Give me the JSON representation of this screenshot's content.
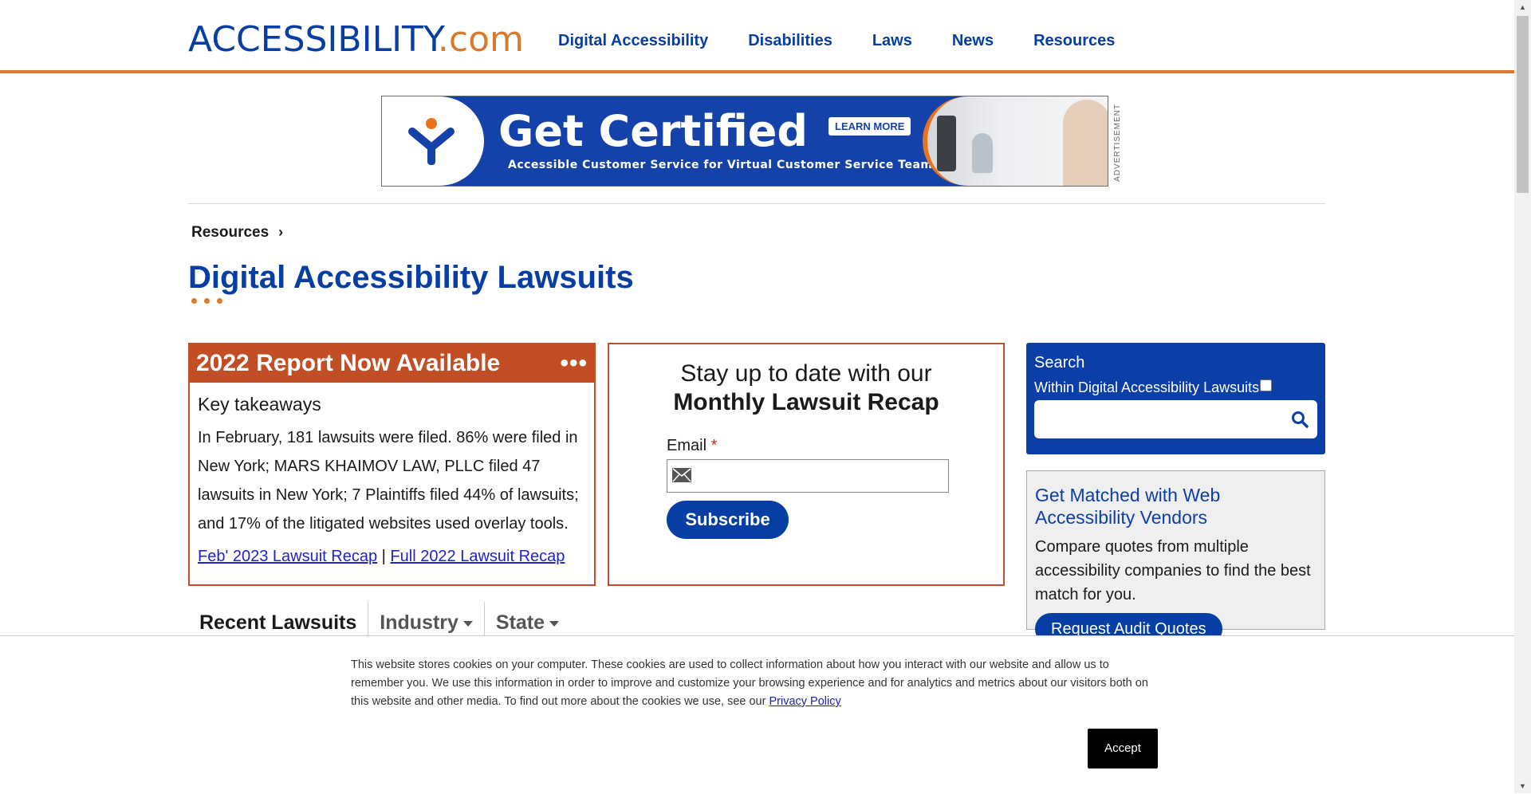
{
  "header": {
    "logo_text": "ACCESSIBILITY",
    "logo_suffix": ".com",
    "nav": [
      "Digital Accessibility",
      "Disabilities",
      "Laws",
      "News",
      "Resources"
    ]
  },
  "ad": {
    "title": "Get Certified",
    "subtitle": "Accessible Customer Service for Virtual Customer Service Teams",
    "cta": "LEARN MORE",
    "label": "ADVERTISEMENT"
  },
  "breadcrumb": {
    "item": "Resources",
    "chevron": "›"
  },
  "page": {
    "title": "Digital Accessibility Lawsuits"
  },
  "report": {
    "heading": "2022 Report Now Available",
    "more": "•••",
    "key_title": "Key takeaways",
    "text": "In February, 181 lawsuits were filed. 86% were filed in New York; MARS KHAIMOV LAW, PLLC filed 47 lawsuits in New York; 7 Plaintiffs filed 44% of lawsuits; and 17% of the litigated websites used overlay tools.",
    "link1": "Feb' 2023 Lawsuit Recap",
    "separator": "|",
    "link2": "Full 2022 Lawsuit Recap"
  },
  "newsletter": {
    "line1": "Stay up to date with our",
    "line2": "Monthly Lawsuit Recap",
    "email_label": "Email",
    "required": "*",
    "email_value": "",
    "subscribe": "Subscribe"
  },
  "search": {
    "title": "Search",
    "within": "Within Digital Accessibility Lawsuits",
    "value": ""
  },
  "vendors": {
    "title": "Get Matched with Web Accessibility Vendors",
    "text": "Compare quotes from multiple accessibility companies to find the best match for you.",
    "button": "Request Audit Quotes"
  },
  "tabs": [
    {
      "label": "Recent Lawsuits"
    },
    {
      "label": "Industry"
    },
    {
      "label": "State"
    }
  ],
  "cookie": {
    "text": "This website stores cookies on your computer. These cookies are used to collect information about how you interact with our website and allow us to remember you. We use this information in order to improve and customize your browsing experience and for analytics and metrics about our visitors both on this website and other media. To find out more about the cookies we use, see our",
    "link": "Privacy Policy",
    "accept": "Accept"
  },
  "colors": {
    "brand_blue": "#063ea3",
    "accent_orange": "#d9792f",
    "report_red": "#c24e25"
  },
  "icons": [
    "accessibility-logo-icon",
    "chevron-right-icon",
    "mail-icon",
    "search-icon",
    "caret-down-icon"
  ]
}
